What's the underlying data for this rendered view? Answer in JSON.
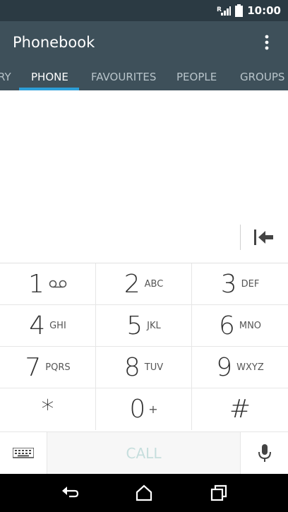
{
  "status": {
    "time": "10:00",
    "signal_label": "R"
  },
  "app": {
    "title": "Phonebook"
  },
  "tabs": [
    {
      "label": "RY"
    },
    {
      "label": "PHONE"
    },
    {
      "label": "FAVOURITES"
    },
    {
      "label": "PEOPLE"
    },
    {
      "label": "GROUPS"
    }
  ],
  "keypad": {
    "rows": [
      [
        {
          "digit": "1",
          "letters": ""
        },
        {
          "digit": "2",
          "letters": "ABC"
        },
        {
          "digit": "3",
          "letters": "DEF"
        }
      ],
      [
        {
          "digit": "4",
          "letters": "GHI"
        },
        {
          "digit": "5",
          "letters": "JKL"
        },
        {
          "digit": "6",
          "letters": "MNO"
        }
      ],
      [
        {
          "digit": "7",
          "letters": "PQRS"
        },
        {
          "digit": "8",
          "letters": "TUV"
        },
        {
          "digit": "9",
          "letters": "WXYZ"
        }
      ],
      [
        {
          "digit": "*",
          "letters": ""
        },
        {
          "digit": "0",
          "letters": "+"
        },
        {
          "digit": "#",
          "letters": ""
        }
      ]
    ]
  },
  "call": {
    "label": "CALL"
  },
  "icons": {
    "voicemail": "voicemail-icon",
    "backspace": "backspace-icon",
    "keyboard": "keyboard-icon",
    "mic": "microphone-icon"
  },
  "colors": {
    "appbar": "#3e505a",
    "statusbar": "#2b3a43",
    "tab_indicator": "#2d9fd8",
    "call_text": "#c6dedd"
  }
}
